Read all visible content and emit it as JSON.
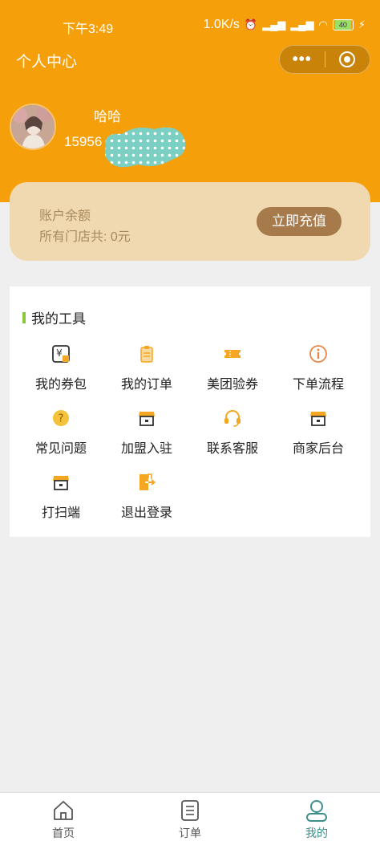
{
  "status_bar": {
    "time": "下午3:49",
    "net_speed": "1.0K/s",
    "battery": "40"
  },
  "title_bar": {
    "title": "个人中心"
  },
  "profile": {
    "name": "哈哈",
    "phone_visible": "15956"
  },
  "balance": {
    "label": "账户余额",
    "subtitle": "所有门店共: 0元",
    "recharge_label": "立即充值"
  },
  "tools": {
    "title": "我的工具",
    "items": [
      {
        "label": "我的券包",
        "icon": "wallet-yen-icon"
      },
      {
        "label": "我的订单",
        "icon": "clipboard-icon"
      },
      {
        "label": "美团验券",
        "icon": "ticket-icon"
      },
      {
        "label": "下单流程",
        "icon": "info-icon"
      },
      {
        "label": "常见问题",
        "icon": "question-icon"
      },
      {
        "label": "加盟入驻",
        "icon": "store-icon"
      },
      {
        "label": "联系客服",
        "icon": "headset-icon"
      },
      {
        "label": "商家后台",
        "icon": "store-icon"
      },
      {
        "label": "打扫端",
        "icon": "store-icon"
      },
      {
        "label": "退出登录",
        "icon": "logout-icon"
      }
    ]
  },
  "tabbar": {
    "items": [
      {
        "label": "首页",
        "icon": "home-icon"
      },
      {
        "label": "订单",
        "icon": "order-list-icon"
      },
      {
        "label": "我的",
        "icon": "user-icon",
        "active": true
      }
    ]
  },
  "colors": {
    "header": "#f5a00a",
    "card": "#f0d9b0",
    "button": "#a77a4b",
    "accent_green": "#8dc63f",
    "icon_orange": "#f5a623",
    "tab_active": "#3c8f8a"
  }
}
